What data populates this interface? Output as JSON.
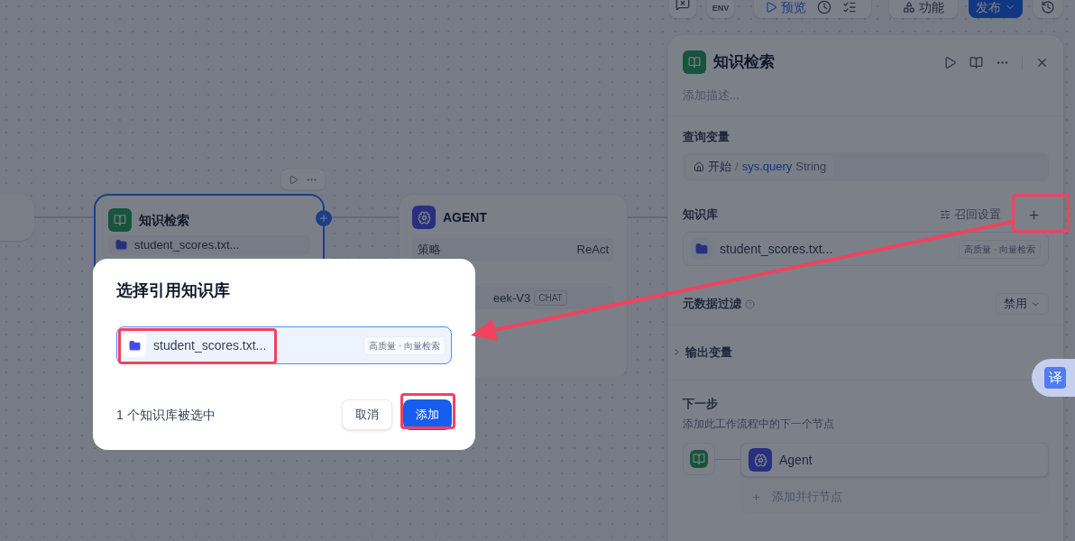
{
  "toolbar": {
    "env": "ENV",
    "preview": "预览",
    "features": "功能",
    "publish": "发布"
  },
  "canvas": {
    "retrieval_node": {
      "title": "知识检索",
      "selected": true,
      "item": "student_scores.txt..."
    },
    "agent_node": {
      "title": "AGENT",
      "rows": [
        {
          "kind": "pair",
          "label": "策略",
          "value": "ReAct"
        },
        {
          "kind": "model",
          "value": "eek-V3",
          "tag": "CHAT"
        }
      ]
    }
  },
  "panel": {
    "title": "知识检索",
    "description_placeholder": "添加描述...",
    "query_label": "查询变量",
    "query": {
      "source": "开始",
      "separator": "/",
      "variable": "sys.query",
      "type": "String"
    },
    "kb_label": "知识库",
    "recall_settings": "召回设置",
    "kb_items": [
      {
        "name": "student_scores.txt...",
        "badge": "高质量 · 向量检索"
      }
    ],
    "metadata_label": "元数据过滤",
    "metadata_value": "禁用",
    "output_label": "输出变量",
    "expanded": false,
    "next_label": "下一步",
    "next_hint": "添加此工作流程中的下一个节点",
    "next_nodes": [
      "Agent"
    ],
    "add_parallel": "添加并行节点"
  },
  "dialog": {
    "title": "选择引用知识库",
    "items": [
      {
        "name": "student_scores.txt...",
        "badge": "高质量 · 向量检索",
        "selected": true
      }
    ],
    "count": "1 个知识库被选中",
    "cancel": "取消",
    "confirm": "添加"
  },
  "translate_widget": {
    "label": "译"
  }
}
